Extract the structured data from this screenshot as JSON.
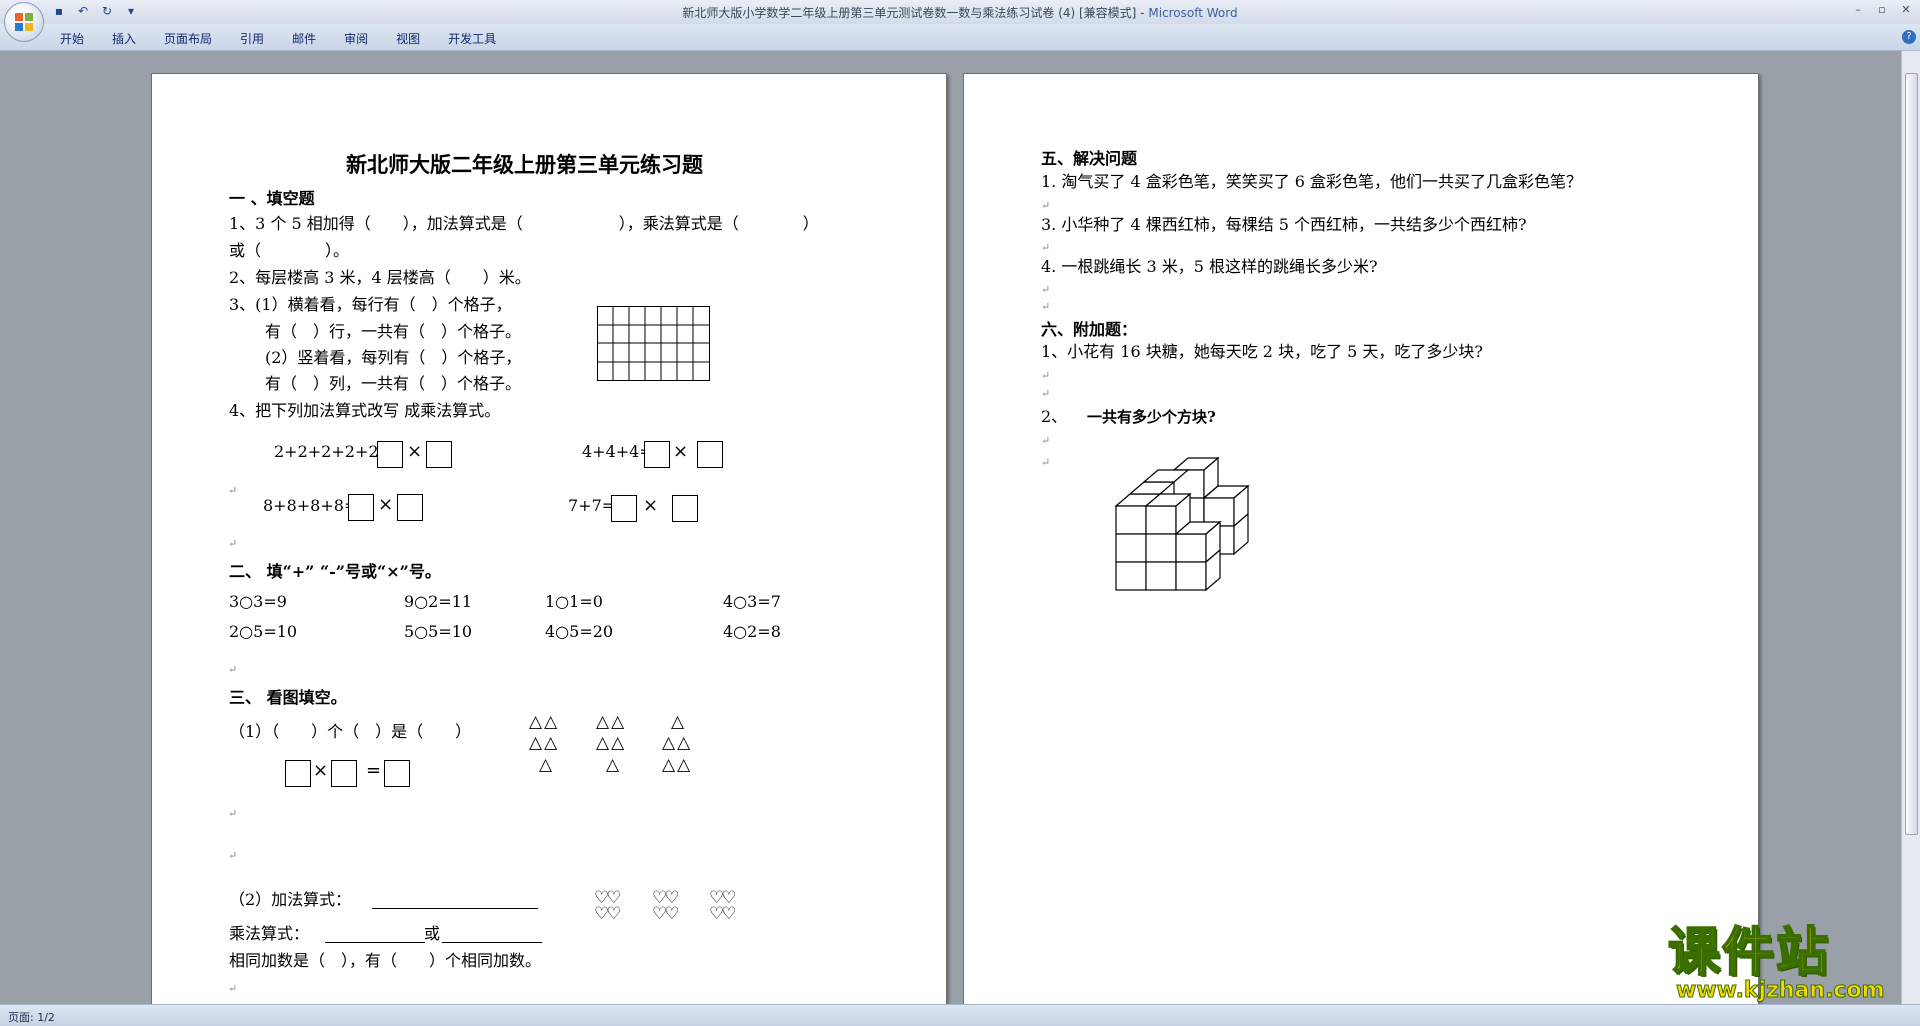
{
  "window": {
    "title": "新北师大版小学数学二年级上册第三单元测试卷数一数与乘法练习试卷 (4) [兼容模式] -",
    "app_name": "Microsoft Word"
  },
  "ribbon": {
    "tabs": [
      "开始",
      "插入",
      "页面布局",
      "引用",
      "邮件",
      "审阅",
      "视图",
      "开发工具"
    ]
  },
  "quick_access": [
    "save-icon",
    "undo-icon",
    "redo-icon",
    "customize-icon"
  ],
  "status": {
    "page_counter": "页面: 1/2"
  },
  "watermark": {
    "title": "课件站",
    "url": "www.kjzhan.com"
  },
  "doc": {
    "title": "新北师大版二年级上册第三单元练习题",
    "s1": {
      "heading": "一 、填空题",
      "q1a": "1、3 个 5 相加得（　　），加法算式是（　　　　　　），乘法算式是（　　　　）",
      "q1b": "或（　　　　）。",
      "q2": "2、每层楼高 3 米，4 层楼高（　　）米。",
      "q3a": "3、(1）横着看，每行有（　）个格子，",
      "q3b": "有（　）行，一共有（　）个格子。",
      "q3c": "(2）竖着看，每列有（　）个格子，",
      "q3d": "有（　）列，一共有（　）个格子。",
      "q4": "4、把下列加法算式改写 成乘法算式。",
      "e1": "2+2+2+2+2=",
      "e2": "4+4+4=",
      "e3": "8+8+8+8=",
      "e4": "7+7="
    },
    "s2": {
      "heading": "二、 填“+” “-”号或“×”号。",
      "row1": [
        "3○3=9",
        "9○2=11",
        "1○1=0",
        "4○3=7"
      ],
      "row2": [
        "2○5=10",
        "5○5=10",
        "4○5=20",
        "4○2=8"
      ]
    },
    "s3": {
      "heading": "三、 看图填空。",
      "p1": "（1）（　　）个（　）是（　　）",
      "p2a": "（2）加法算式：",
      "p2b": "乘法算式：",
      "p2or": "或",
      "p2c": "相同加数是（　），有（　　）个相同加数。",
      "tri": "△",
      "heart": "♡"
    },
    "s5": {
      "heading": "五、解决问题",
      "q1": "1. 淘气买了 4 盒彩色笔，笑笑买了 6 盒彩色笔，他们一共买了几盒彩色笔？",
      "q3": "3. 小华种了 4 棵西红柿，每棵结 5 个西红柿，一共结多少个西红柿?",
      "q4": "4. 一根跳绳长 3 米，5 根这样的跳绳长多少米?"
    },
    "s6": {
      "heading": "六、附加题：",
      "q1": "1、小花有 16 块糖，她每天吃 2 块，吃了 5 天，吃了多少块?",
      "q2": "2、",
      "q2b": "一共有多少个方块?"
    },
    "symbols": {
      "times": "×",
      "equals": "=",
      "para": "↵"
    }
  }
}
